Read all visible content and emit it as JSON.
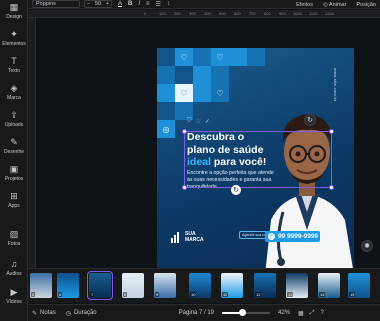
{
  "sidebar": {
    "items": [
      {
        "label": "Design",
        "icon": "▦"
      },
      {
        "label": "Elementos",
        "icon": "✦"
      },
      {
        "label": "Texto",
        "icon": "T"
      },
      {
        "label": "Marca",
        "icon": "◈"
      },
      {
        "label": "Uploads",
        "icon": "⇧"
      },
      {
        "label": "Desenhe",
        "icon": "✎"
      },
      {
        "label": "Projetos",
        "icon": "▣"
      },
      {
        "label": "Apps",
        "icon": "⊞"
      },
      {
        "label": "Fotos",
        "icon": "▨"
      },
      {
        "label": "Áudios",
        "icon": "♫"
      },
      {
        "label": "Vídeos",
        "icon": "▶"
      }
    ]
  },
  "toolbar": {
    "font": "Poppins",
    "font_size": "50",
    "bold": "B",
    "italic": "I",
    "effects": "Efeitos",
    "animate": "Animar",
    "position": "Posição"
  },
  "ruler": {
    "top": [
      "0",
      "100",
      "200",
      "300",
      "400",
      "500",
      "600",
      "700",
      "800",
      "900",
      "1000",
      "1100",
      "1200"
    ]
  },
  "design": {
    "url": "www.site.com.br",
    "headline": {
      "line1": "Descubra o",
      "line2": "plano de saúde",
      "line3a": "ideal",
      "line3b": " para você!"
    },
    "subtext": "Encontre a opção perfeita que atende às suas necessidades e garanta sua tranquilidade.",
    "brand_line1": "SUA",
    "brand_line2": "MARCA",
    "appointment": "Agende sua consulta",
    "phone": "99 9999-9999",
    "accent_color": "#39b6ff",
    "selection_color": "#7c5cf2"
  },
  "pages": {
    "thumbnails": [
      "5",
      "6",
      "7",
      "8",
      "9",
      "10",
      "11",
      "12",
      "13",
      "14",
      "15",
      "16"
    ],
    "active": "7",
    "add_icon": "+"
  },
  "bottom": {
    "notes": "Notas",
    "duration": "Duração",
    "page_indicator": "Página 7 / 19",
    "zoom": "42%",
    "zoom_fraction": 0.42
  }
}
